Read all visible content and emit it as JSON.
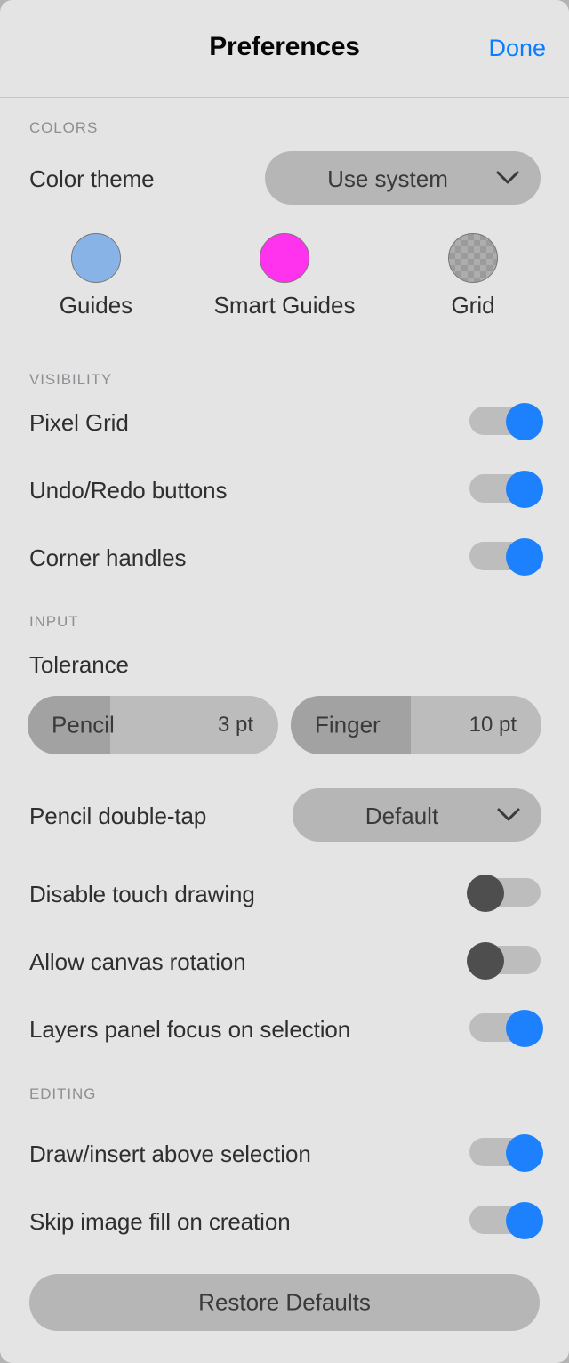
{
  "header": {
    "title": "Preferences",
    "done_label": "Done",
    "done_color": "#0a7cff"
  },
  "sections": {
    "colors": {
      "title": "COLORS",
      "color_theme": {
        "label": "Color theme",
        "value": "Use system",
        "chevron_icon": "chevron-down-icon"
      },
      "swatches": [
        {
          "label": "Guides",
          "color": "#88b3e6",
          "icon": "color-swatch-circle"
        },
        {
          "label": "Smart Guides",
          "color": "#ff33ee",
          "icon": "color-swatch-circle"
        },
        {
          "label": "Grid",
          "color": "checkerboard",
          "icon": "color-swatch-circle"
        }
      ]
    },
    "visibility": {
      "title": "VISIBILITY",
      "rows": [
        {
          "label": "Pixel Grid",
          "state": "on"
        },
        {
          "label": "Undo/Redo buttons",
          "state": "on"
        },
        {
          "label": "Corner handles",
          "state": "on"
        }
      ]
    },
    "input": {
      "title": "INPUT",
      "tolerance_label": "Tolerance",
      "tolerance_sliders": [
        {
          "name": "Pencil",
          "value": "3 pt",
          "fill_percent": 33
        },
        {
          "name": "Finger",
          "value": "10 pt",
          "fill_percent": 48
        }
      ],
      "pencil_double_tap": {
        "label": "Pencil double-tap",
        "value": "Default",
        "chevron_icon": "chevron-down-icon"
      },
      "rows": [
        {
          "label": "Disable touch drawing",
          "state": "off"
        },
        {
          "label": "Allow canvas rotation",
          "state": "off"
        },
        {
          "label": "Layers panel focus on selection",
          "state": "on"
        }
      ]
    },
    "editing": {
      "title": "EDITING",
      "rows": [
        {
          "label": "Draw/insert above selection",
          "state": "on"
        },
        {
          "label": "Skip image fill on creation",
          "state": "on"
        }
      ]
    }
  },
  "footer": {
    "restore_defaults_label": "Restore Defaults"
  },
  "colors": {
    "accent_blue": "#1d80fc",
    "panel_background": "#e4e4e4",
    "control_gray": "#b6b6b6",
    "toggle_off_thumb": "#4e4e4e"
  }
}
